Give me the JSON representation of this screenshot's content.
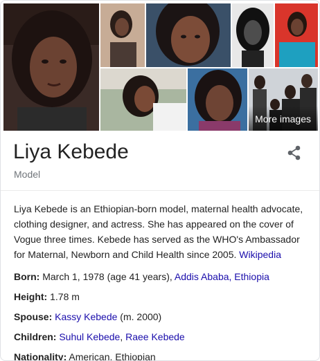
{
  "gallery": {
    "more_images_label": "More images"
  },
  "header": {
    "name": "Liya Kebede",
    "occupation": "Model"
  },
  "description": {
    "text": "Liya Kebede is an Ethiopian-born model, maternal health advocate, clothing designer, and actress. She has appeared on the cover of Vogue three times. Kebede has served as the WHO's Ambassador for Maternal, Newborn and Child Health since 2005. ",
    "source_link": "Wikipedia"
  },
  "facts": {
    "born": {
      "label": "Born:",
      "text": " March 1, 1978 (age 41 years), ",
      "link": "Addis Ababa, Ethiopia"
    },
    "height": {
      "label": "Height:",
      "text": " 1.78 m"
    },
    "spouse": {
      "label": "Spouse:",
      "link": "Kassy Kebede",
      "text_after": " (m. 2000)"
    },
    "children": {
      "label": "Children:",
      "link1": "Suhul Kebede",
      "sep": ", ",
      "link2": "Raee Kebede"
    },
    "nationality": {
      "label": "Nationality:",
      "text": " American, Ethiopian"
    }
  },
  "colors": {
    "link": "#1a0dab",
    "muted": "#70757a",
    "border": "#dfe1e5"
  },
  "icons": {
    "share": "share-icon"
  }
}
